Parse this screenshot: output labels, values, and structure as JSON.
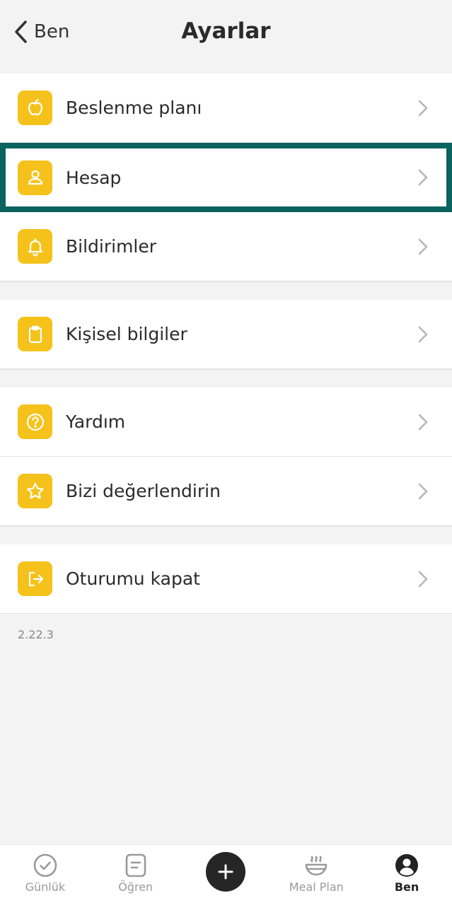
{
  "header": {
    "back_label": "Ben",
    "title": "Ayarlar"
  },
  "groups": [
    {
      "items": [
        {
          "label": "Beslenme planı",
          "icon": "apple-icon"
        },
        {
          "label": "Hesap",
          "icon": "user-icon"
        },
        {
          "label": "Bildirimler",
          "icon": "bell-icon"
        }
      ]
    },
    {
      "items": [
        {
          "label": "Kişisel bilgiler",
          "icon": "clipboard-icon"
        }
      ]
    },
    {
      "items": [
        {
          "label": "Yardım",
          "icon": "question-icon"
        },
        {
          "label": "Bizi değerlendirin",
          "icon": "star-icon"
        }
      ]
    },
    {
      "items": [
        {
          "label": "Oturumu kapat",
          "icon": "logout-icon"
        }
      ]
    }
  ],
  "version": "2.22.3",
  "tabbar": {
    "tabs": [
      {
        "label": "Günlük",
        "icon": "check-circle-icon"
      },
      {
        "label": "Öğren",
        "icon": "notebook-icon"
      },
      {
        "label": "",
        "icon": "plus-icon"
      },
      {
        "label": "Meal Plan",
        "icon": "bowl-icon"
      },
      {
        "label": "Ben",
        "icon": "profile-icon"
      }
    ]
  },
  "colors": {
    "accent": "#f5c21b",
    "highlight": "#0b6360",
    "background": "#f3f3f3"
  }
}
